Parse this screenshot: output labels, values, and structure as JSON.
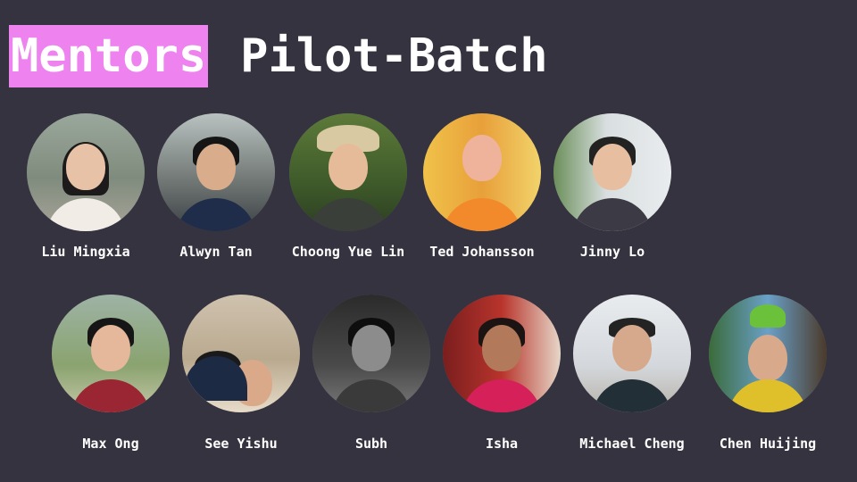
{
  "title": {
    "highlight": "Mentors",
    "rest": "Pilot-Batch"
  },
  "colors": {
    "background": "#353340",
    "highlight": "#ee82ee",
    "text": "#ffffff"
  },
  "mentors_row1": [
    {
      "name": "Liu Mingxia",
      "photo": "avatar-photo"
    },
    {
      "name": "Alwyn Tan",
      "photo": "avatar-photo"
    },
    {
      "name": "Choong Yue Lin",
      "photo": "avatar-photo"
    },
    {
      "name": "Ted Johansson",
      "photo": "avatar-photo"
    },
    {
      "name": "Jinny Lo",
      "photo": "avatar-photo"
    }
  ],
  "mentors_row2": [
    {
      "name": "Max Ong",
      "photo": "avatar-photo"
    },
    {
      "name": "See Yishu",
      "photo": "avatar-photo"
    },
    {
      "name": "Subh",
      "photo": "avatar-photo"
    },
    {
      "name": "Isha",
      "photo": "avatar-photo"
    },
    {
      "name": "Michael Cheng",
      "photo": "avatar-photo"
    },
    {
      "name": "Chen Huijing",
      "photo": "avatar-photo"
    }
  ]
}
